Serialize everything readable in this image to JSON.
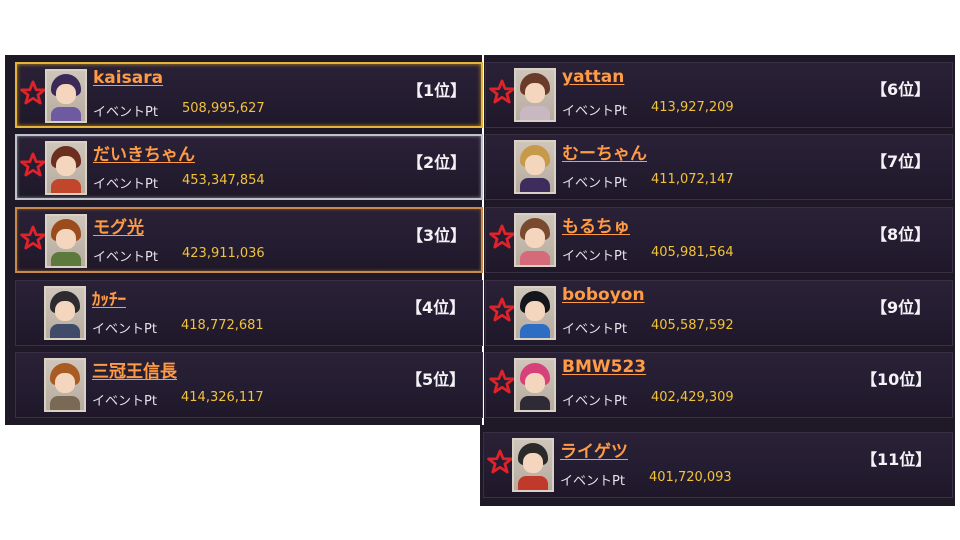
{
  "colors": {
    "panel_bg": "#1f1826",
    "name": "#ff9a45",
    "points": "#f2c23a",
    "star": "#e0222a",
    "frame_gold": "#e4b43a",
    "frame_silver": "#bfc3c9",
    "frame_bronze": "#c98a4e"
  },
  "icons": {
    "star": "star-icon"
  },
  "ranking": [
    {
      "name": "kaisara",
      "pt_label": "イベントPt",
      "points": "508,995,627",
      "rank": "【1位】",
      "star": true,
      "avatar": "player-avatar"
    },
    {
      "name": "だいきちゃん",
      "pt_label": "イベントPt",
      "points": "453,347,854",
      "rank": "【2位】",
      "star": true,
      "avatar": "player-avatar"
    },
    {
      "name": "モグ光",
      "pt_label": "イベントPt",
      "points": "423,911,036",
      "rank": "【3位】",
      "star": true,
      "avatar": "player-avatar"
    },
    {
      "name": "ｶｯﾁｰ",
      "pt_label": "イベントPt",
      "points": "418,772,681",
      "rank": "【4位】",
      "star": false,
      "avatar": "player-avatar"
    },
    {
      "name": "三冠王信長",
      "pt_label": "イベントPt",
      "points": "414,326,117",
      "rank": "【5位】",
      "star": false,
      "avatar": "player-avatar"
    },
    {
      "name": "yattan",
      "pt_label": "イベントPt",
      "points": "413,927,209",
      "rank": "【6位】",
      "star": true,
      "avatar": "player-avatar"
    },
    {
      "name": "むーちゃん",
      "pt_label": "イベントPt",
      "points": "411,072,147",
      "rank": "【7位】",
      "star": false,
      "avatar": "player-avatar"
    },
    {
      "name": "もるちゅ",
      "pt_label": "イベントPt",
      "points": "405,981,564",
      "rank": "【8位】",
      "star": true,
      "avatar": "player-avatar"
    },
    {
      "name": "boboyon",
      "pt_label": "イベントPt",
      "points": "405,587,592",
      "rank": "【9位】",
      "star": true,
      "avatar": "player-avatar"
    },
    {
      "name": "BMW523",
      "pt_label": "イベントPt",
      "points": "402,429,309",
      "rank": "【10位】",
      "star": true,
      "avatar": "player-avatar"
    },
    {
      "name": "ライゲツ",
      "pt_label": "イベントPt",
      "points": "401,720,093",
      "rank": "【11位】",
      "star": true,
      "avatar": "player-avatar"
    }
  ]
}
